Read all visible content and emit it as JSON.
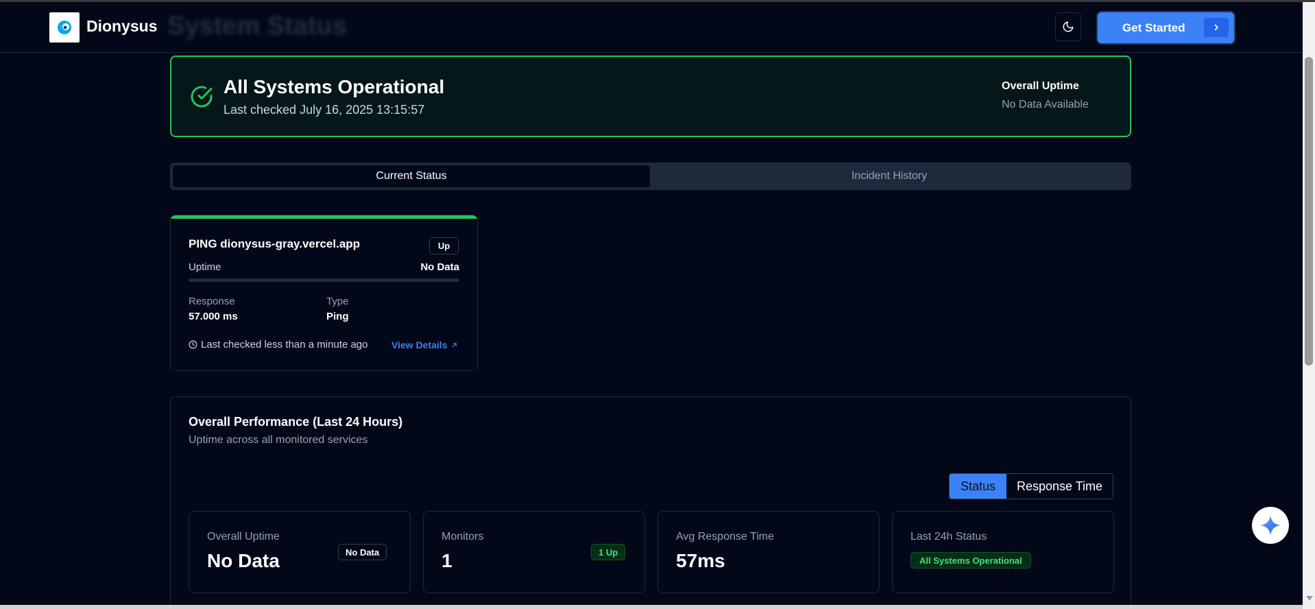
{
  "header": {
    "brand": "Dionysus",
    "page_title": "System Status",
    "cta_label": "Get Started"
  },
  "banner": {
    "title": "All Systems Operational",
    "last_checked": "Last checked July 16, 2025 13:15:57",
    "uptime_label": "Overall Uptime",
    "uptime_value": "No Data Available"
  },
  "tabs": [
    {
      "label": "Current Status",
      "active": true
    },
    {
      "label": "Incident History",
      "active": false
    }
  ],
  "monitor": {
    "name": "PING dionysus-gray.vercel.app",
    "status_badge": "Up",
    "uptime_label": "Uptime",
    "uptime_value": "No Data",
    "uptime_fraction": 0,
    "response_label": "Response",
    "response_value": "57.000 ms",
    "type_label": "Type",
    "type_value": "Ping",
    "last_checked": "Last checked less than a minute ago",
    "details_link": "View Details"
  },
  "performance": {
    "title": "Overall Performance (Last 24 Hours)",
    "subtitle": "Uptime across all monitored services",
    "toggle": [
      "Status",
      "Response Time"
    ],
    "stats": [
      {
        "label": "Overall Uptime",
        "value": "No Data",
        "badge": "No Data"
      },
      {
        "label": "Monitors",
        "value": "1",
        "badge": "1 Up"
      },
      {
        "label": "Avg Response Time",
        "value": "57ms"
      },
      {
        "label": "Last 24h Status",
        "badge": "All Systems Operational"
      }
    ]
  },
  "colors": {
    "background": "#020817",
    "accent": "#3b82f6",
    "success": "#22c55e"
  }
}
